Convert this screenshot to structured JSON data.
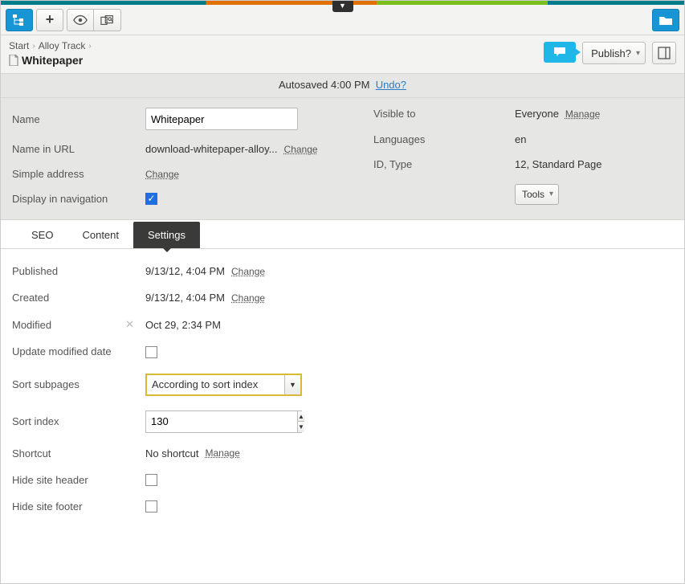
{
  "breadcrumb": {
    "items": [
      "Start",
      "Alloy Track"
    ],
    "title": "Whitepaper"
  },
  "header": {
    "publish_label": "Publish?"
  },
  "autosave": {
    "text": "Autosaved 4:00 PM",
    "undo": "Undo?"
  },
  "props_left": {
    "name_label": "Name",
    "name_value": "Whitepaper",
    "url_label": "Name in URL",
    "url_value": "download-whitepaper-alloy...",
    "url_change": "Change",
    "simple_label": "Simple address",
    "simple_change": "Change",
    "display_label": "Display in navigation"
  },
  "props_right": {
    "visible_label": "Visible to",
    "visible_value": "Everyone",
    "visible_manage": "Manage",
    "lang_label": "Languages",
    "lang_value": "en",
    "id_label": "ID, Type",
    "id_value": "12, Standard Page",
    "tools_label": "Tools"
  },
  "tabs": {
    "seo": "SEO",
    "content": "Content",
    "settings": "Settings"
  },
  "settings": {
    "published_label": "Published",
    "published_value": "9/13/12, 4:04 PM",
    "published_change": "Change",
    "created_label": "Created",
    "created_value": "9/13/12, 4:04 PM",
    "created_change": "Change",
    "modified_label": "Modified",
    "modified_value": "Oct 29, 2:34 PM",
    "update_label": "Update modified date",
    "sortsub_label": "Sort subpages",
    "sortsub_value": "According to sort index",
    "sortidx_label": "Sort index",
    "sortidx_value": "130",
    "shortcut_label": "Shortcut",
    "shortcut_value": "No shortcut",
    "shortcut_manage": "Manage",
    "hideheader_label": "Hide site header",
    "hidefooter_label": "Hide site footer"
  }
}
